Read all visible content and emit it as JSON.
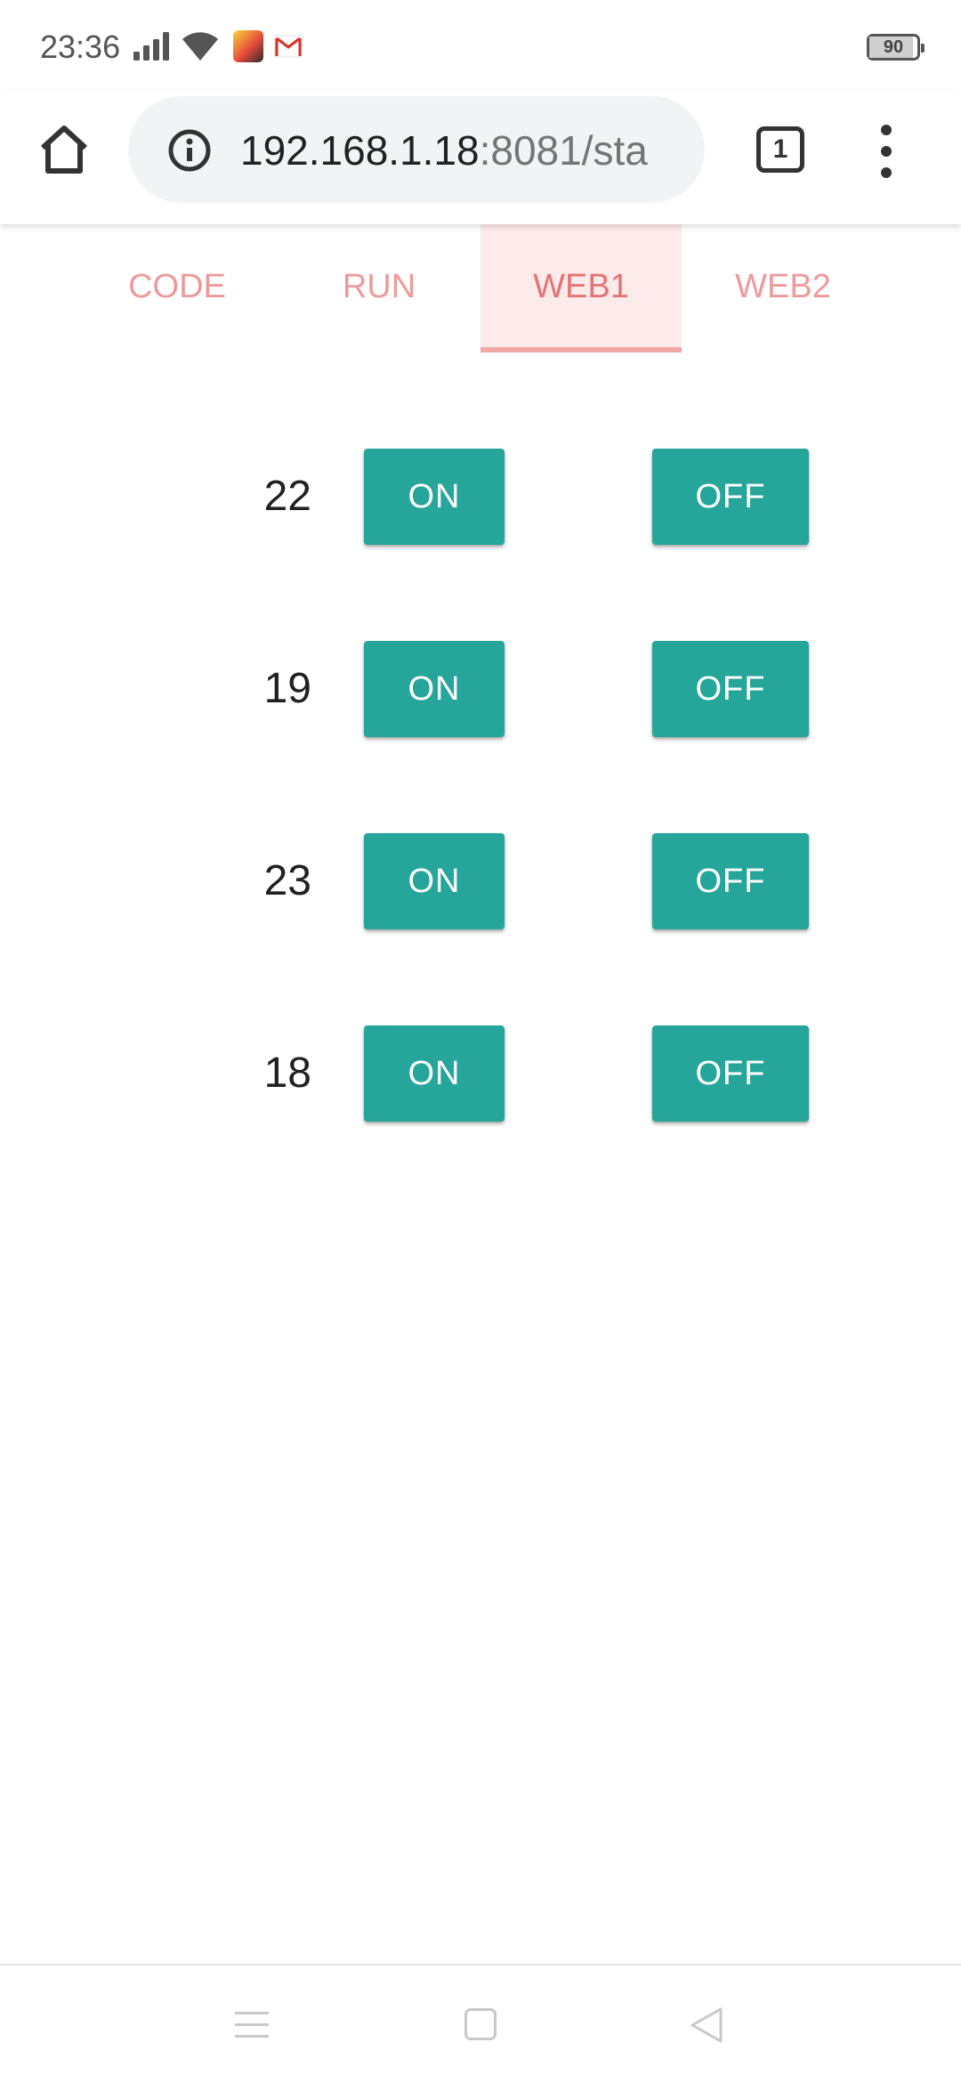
{
  "status_bar": {
    "time": "23:36",
    "battery": "90",
    "battery_level": 0.9,
    "icons": [
      "signal-icon",
      "wifi-icon",
      "game-app-icon",
      "gmail-icon",
      "battery-icon"
    ]
  },
  "browser": {
    "url_host": "192.168.1.18",
    "url_path": ":8081/sta",
    "tab_count": "1",
    "icons": [
      "home-icon",
      "info-icon",
      "tab-switcher-icon",
      "more-vert-icon"
    ]
  },
  "tabs": [
    {
      "label": "CODE",
      "active": false
    },
    {
      "label": "RUN",
      "active": false
    },
    {
      "label": "WEB1",
      "active": true
    },
    {
      "label": "WEB2",
      "active": false
    }
  ],
  "pins": [
    {
      "pin": "22",
      "on_label": "ON",
      "off_label": "OFF"
    },
    {
      "pin": "19",
      "on_label": "ON",
      "off_label": "OFF"
    },
    {
      "pin": "23",
      "on_label": "ON",
      "off_label": "OFF"
    },
    {
      "pin": "18",
      "on_label": "ON",
      "off_label": "OFF"
    }
  ],
  "colors": {
    "button": "#26a69a",
    "tab_text": "#ee9a9a",
    "tab_active_bg": "#fdeaea",
    "tab_active_text": "#e57373"
  },
  "nav_bar": {
    "icons": [
      "menu-icon",
      "home-square-icon",
      "back-triangle-icon"
    ]
  }
}
